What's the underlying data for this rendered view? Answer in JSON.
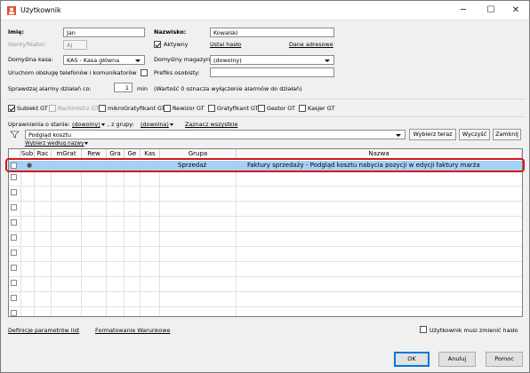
{
  "window": {
    "title": "Użytkownik",
    "minimize_glyph": "─",
    "maximize_glyph": "☐",
    "close_glyph": "✕"
  },
  "form": {
    "imie_label": "Imię:",
    "imie_value": "Jan",
    "nazwisko_label": "Nazwisko:",
    "nazwisko_value": "Kowalski",
    "identyfikator_label": "Identyfikator:",
    "identyfikator_value": "AJ",
    "aktywny_label": "Aktywny",
    "aktywny_checked": true,
    "ustal_haslo": "Ustal hasło",
    "dane_adresowe": "Dane adresowe",
    "kasa_label": "Domyślna kasa:",
    "kasa_value": "KAS - Kasa główna",
    "magazyn_label": "Domyślny magazyn:",
    "magazyn_value": "(dowolny)",
    "obsluga_label": "Uruchom obsługę telefonów i komunikatorów",
    "prefiks_label": "Prefiks osobisty:",
    "prefiks_value": "",
    "alarm_label": "Sprawdzaj alarmy działań co:",
    "alarm_value": "1",
    "alarm_unit": "min",
    "alarm_note": "(Wartość 0 oznacza wyłączenie alarmów do działań)"
  },
  "modules": [
    {
      "label": "Subiekt GT",
      "checked": true,
      "disabled": false
    },
    {
      "label": "Rachmistrz GT",
      "checked": false,
      "disabled": true
    },
    {
      "label": "mikroGratyfikant GT",
      "checked": false,
      "disabled": false
    },
    {
      "label": "Rewizor GT",
      "checked": false,
      "disabled": false
    },
    {
      "label": "Gratyfikant GT",
      "checked": false,
      "disabled": false
    },
    {
      "label": "Gestor GT",
      "checked": false,
      "disabled": false
    },
    {
      "label": "Kasjer GT",
      "checked": false,
      "disabled": false
    }
  ],
  "permissions": {
    "label": "Uprawnienia o stanie:",
    "state_value": "(dowolny)",
    "group_label": ", z grupy:",
    "group_value": "(dowolna)",
    "select_all": "Zaznacz wszystkie",
    "view_value": "Podgląd kosztu",
    "choose_now": "Wybierz teraz",
    "clear": "Wyczyść",
    "collapse": "Zamknij",
    "choose_by_name": "Wybierz według nazwy"
  },
  "table": {
    "columns": [
      "Sub",
      "Rac",
      "mGrat",
      "Rew",
      "Gra",
      "Ge",
      "Kas",
      "Grupa",
      "Nazwa"
    ],
    "rows": [
      {
        "sub_marker": "●",
        "grupa": "Sprzedaż",
        "nazwa": "Faktury sprzedaży - Podgląd kosztu nabycia pozycji w edycji faktury marża"
      }
    ]
  },
  "footer": {
    "def_params": "Definicje parametrów list",
    "cond_format": "Formatowanie Warunkowe",
    "must_change_password": "Użytkownik musi zmienić hasło",
    "ok": "OK",
    "cancel": "Anuluj",
    "help": "Pomoc"
  },
  "colors": {
    "selection": "#a6d1f5",
    "highlight_border": "#d8141c",
    "default_button": "#0078d7"
  }
}
